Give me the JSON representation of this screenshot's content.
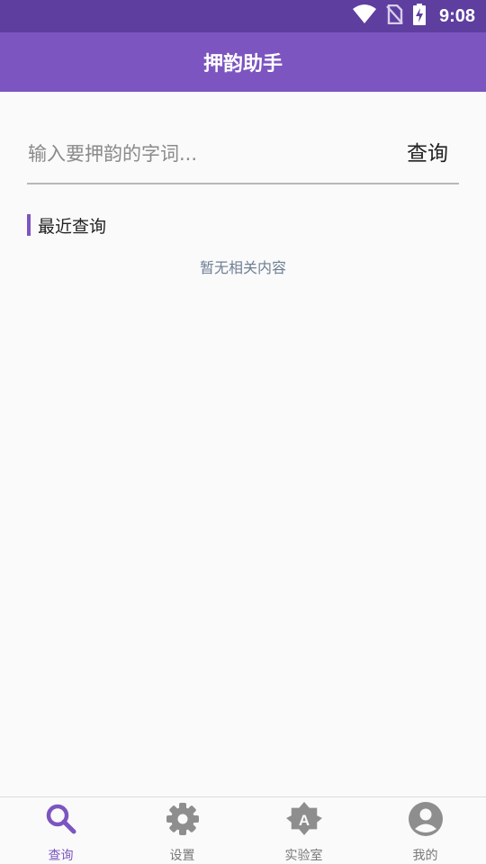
{
  "status_bar": {
    "time": "9:08"
  },
  "app_bar": {
    "title": "押韵助手"
  },
  "search": {
    "placeholder": "输入要押韵的字词...",
    "value": "",
    "button_label": "查询"
  },
  "recent": {
    "heading": "最近查询",
    "empty_text": "暂无相关内容"
  },
  "bottom_nav": {
    "items": [
      {
        "label": "查询",
        "icon": "search-icon",
        "active": true
      },
      {
        "label": "设置",
        "icon": "gear-icon",
        "active": false
      },
      {
        "label": "实验室",
        "icon": "auto-brightness-icon",
        "active": false
      },
      {
        "label": "我的",
        "icon": "account-circle-icon",
        "active": false
      }
    ]
  },
  "colors": {
    "status_bar": "#5e3e9f",
    "accent": "#7c55c0",
    "inactive_icon": "#8e8e8e",
    "background": "#fafafa"
  }
}
